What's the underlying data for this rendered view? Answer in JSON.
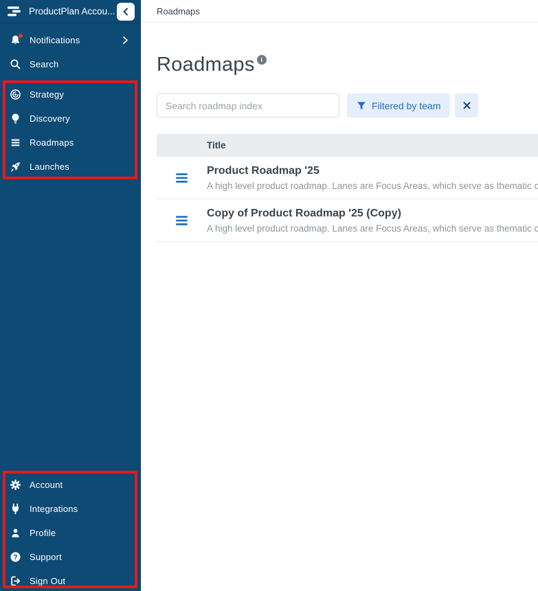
{
  "colors": {
    "sidebar_bg": "#0d4a74",
    "annotation_red": "#e51a1a",
    "accent_blue": "#1f6fc0",
    "chip_bg": "#e4effb",
    "table_header_bg": "#e9edf0",
    "text_dark": "#39444d",
    "text_gray": "#8c959c",
    "notification_badge": "#e03a30"
  },
  "sidebar": {
    "account_title": "ProductPlan Accou...",
    "logo_icon": "productplan-logo-icon",
    "collapse_icon": "chevron-left-icon",
    "top": [
      {
        "label": "Notifications",
        "icon": "bell-icon",
        "badge": true,
        "chevron": "chevron-right-icon"
      },
      {
        "label": "Search",
        "icon": "search-icon"
      }
    ],
    "nav": [
      {
        "label": "Strategy",
        "icon": "strategy-target-icon"
      },
      {
        "label": "Discovery",
        "icon": "lightbulb-icon"
      },
      {
        "label": "Roadmaps",
        "icon": "roadmap-lines-icon"
      },
      {
        "label": "Launches",
        "icon": "rocket-icon"
      }
    ],
    "bottom": [
      {
        "label": "Account",
        "icon": "gear-icon"
      },
      {
        "label": "Integrations",
        "icon": "plug-icon"
      },
      {
        "label": "Profile",
        "icon": "person-icon"
      },
      {
        "label": "Support",
        "icon": "question-circle-icon"
      },
      {
        "label": "Sign Out",
        "icon": "sign-out-icon"
      }
    ]
  },
  "topbar": {
    "breadcrumb": "Roadmaps"
  },
  "main": {
    "title": "Roadmaps",
    "info_icon": "i",
    "search_placeholder": "Search roadmap index",
    "filter_chip_label": "Filtered by team",
    "table": {
      "header": "Title",
      "rows": [
        {
          "title": "Product Roadmap '25",
          "description": "A high level product roadmap. Lanes are Focus Areas, which serve as thematic cat"
        },
        {
          "title": "Copy of Product Roadmap '25 (Copy)",
          "description": "A high level product roadmap. Lanes are Focus Areas, which serve as thematic cat"
        }
      ]
    }
  }
}
